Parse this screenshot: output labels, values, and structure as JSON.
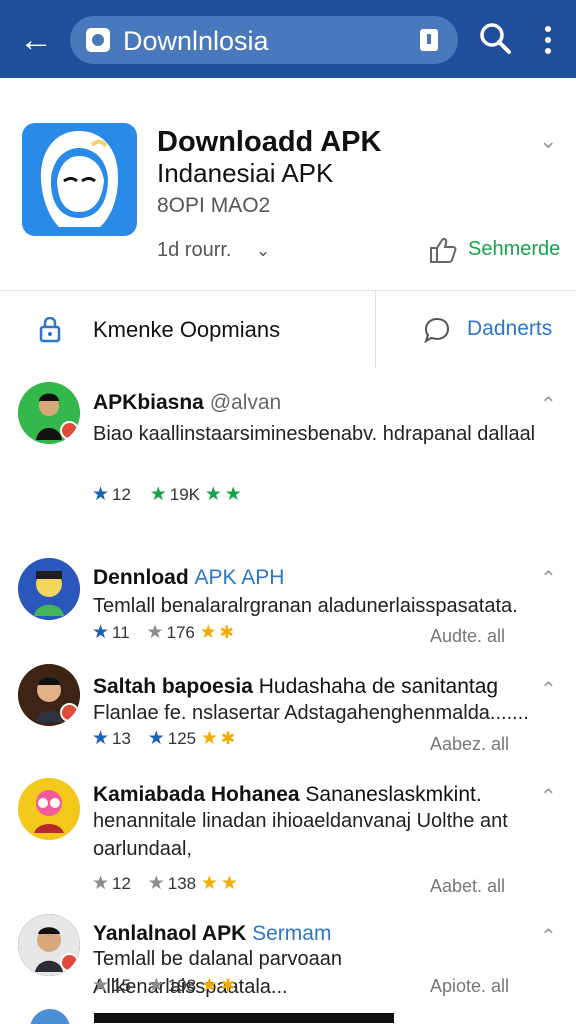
{
  "header": {
    "search_text": "Downlnlosia"
  },
  "app": {
    "title": "Downloadd APK",
    "subtitle": "Indanesiai APK",
    "size": "8OPI MAO2",
    "time": "1d rourr.",
    "share_label": "Sehmerde",
    "logo_color": "#2a8ae8"
  },
  "actions": {
    "left_label": "Kmenke Oopmians",
    "right_label": "Dadnerts"
  },
  "reviews": [
    {
      "name": "APKbiasna",
      "handle": "@alvan",
      "text": "Biao kaallinstaarsiminesbenabv. hdrapanal dallaal",
      "stars": "12",
      "count": "19K"
    },
    {
      "name": "Dennload",
      "handle": "APK APH",
      "text": "Temlall benalaralrgranan aladunerlaisspasatata.",
      "stars": "11",
      "count": "176",
      "action": "Audte. all"
    },
    {
      "name": "Saltah bapoesia",
      "handle": "Hudashaha de sanitantag",
      "text": "Flanlae fe. nslasertar Adstagahenghenmalda.......",
      "stars": "13",
      "count": "125",
      "action": "Aabez. all"
    },
    {
      "name": "Kamiabada Hohanea",
      "handle": "Sananeslaskmkint.",
      "text": "henannitale linadan ihioaeldanvanaj Uolthe ant oarlundaal,",
      "stars": "12",
      "count": "138",
      "action": "Aabet. all"
    },
    {
      "name": "Yanlalnaol APK",
      "handle": "Sermam",
      "text": "Temlall be dalanal parvoaan Allkenarlaisspaatala...",
      "stars": "15",
      "count": "198",
      "action": "Apiote. all"
    }
  ]
}
